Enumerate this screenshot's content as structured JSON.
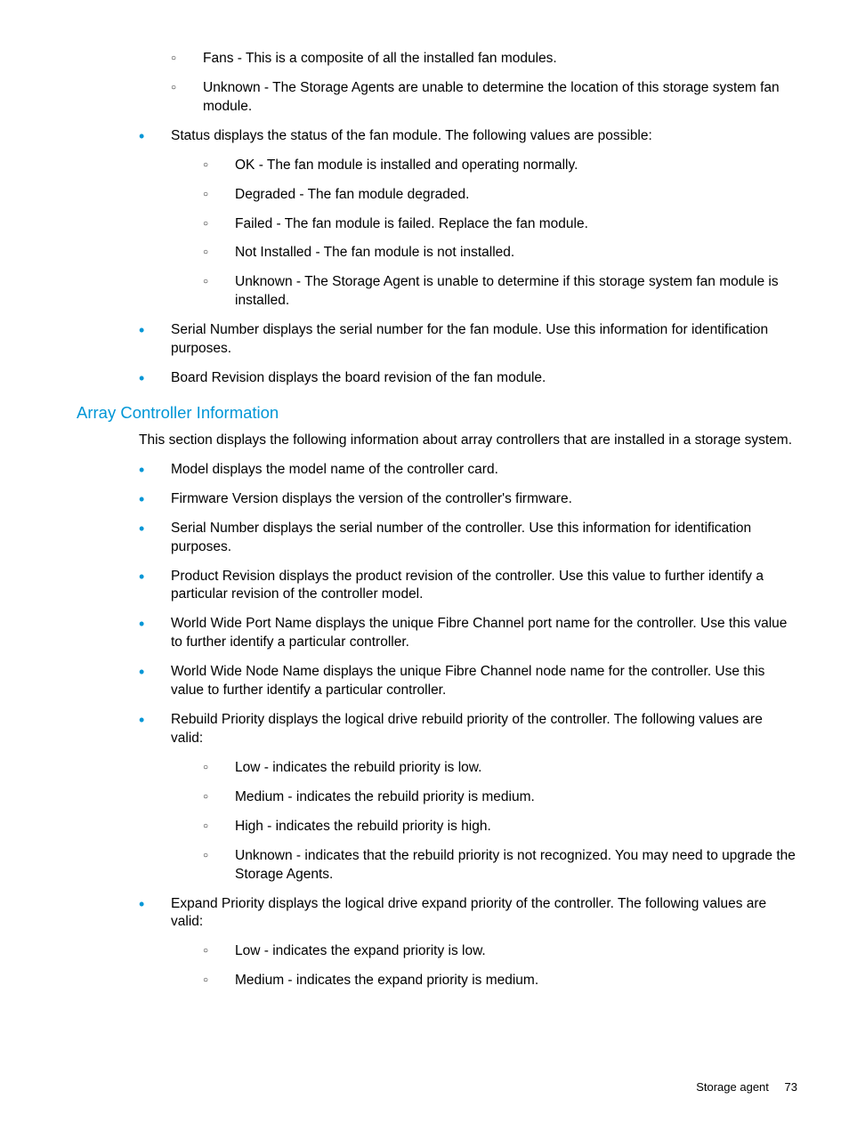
{
  "top_sublist": [
    "Fans - This is a composite of all the installed fan modules.",
    "Unknown - The Storage Agents are unable to determine the location of this storage system fan module."
  ],
  "fan_items": [
    {
      "text": "Status displays the status of the fan module. The following values are possible:",
      "sub": [
        "OK - The fan module is installed and operating normally.",
        "Degraded - The fan module degraded.",
        "Failed - The fan module is failed. Replace the fan module.",
        "Not Installed - The fan module is not installed.",
        "Unknown - The Storage Agent is unable to determine if this storage system fan module is installed."
      ]
    },
    {
      "text": "Serial Number displays the serial number for the fan module. Use this information for identification purposes."
    },
    {
      "text": "Board Revision displays the board revision of the fan module."
    }
  ],
  "section_heading": "Array Controller Information",
  "section_intro": "This section displays the following information about array controllers that are installed in a storage system.",
  "array_items": [
    {
      "text": "Model displays the model name of the controller card."
    },
    {
      "text": "Firmware Version displays the version of the controller's firmware."
    },
    {
      "text": "Serial Number displays the serial number of the controller. Use this information for identification purposes."
    },
    {
      "text": "Product Revision displays the product revision of the controller. Use this value to further identify a particular revision of the controller model."
    },
    {
      "text": "World Wide Port Name displays the unique Fibre Channel port name for the controller. Use this value to further identify a particular controller."
    },
    {
      "text": "World Wide Node Name displays the unique Fibre Channel node name for the controller. Use this value to further identify a particular controller."
    },
    {
      "text": "Rebuild Priority displays the logical drive rebuild priority of the controller. The following values are valid:",
      "sub": [
        "Low - indicates the rebuild priority is low.",
        "Medium - indicates the rebuild priority is medium.",
        "High - indicates the rebuild priority is high.",
        "Unknown - indicates that the rebuild priority is not recognized. You may need to upgrade the Storage Agents."
      ]
    },
    {
      "text": "Expand Priority displays the logical drive expand priority of the controller. The following values are valid:",
      "sub": [
        "Low - indicates the expand priority is low.",
        "Medium - indicates the expand priority is medium."
      ]
    }
  ],
  "footer": {
    "label": "Storage agent",
    "page": "73"
  }
}
